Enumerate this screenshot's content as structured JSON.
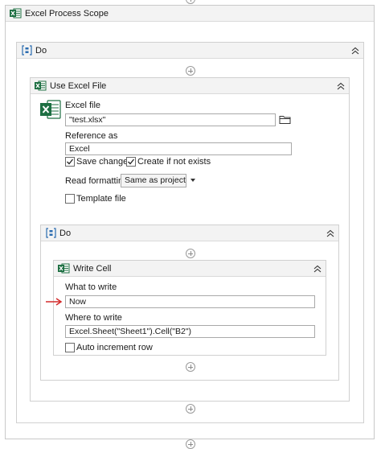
{
  "excel_scope": {
    "title": "Excel Process Scope"
  },
  "outer_do": {
    "title": "Do"
  },
  "use_excel": {
    "title": "Use Excel File",
    "excel_file_label": "Excel file",
    "excel_file_value": "\"test.xlsx\"",
    "reference_label": "Reference as",
    "reference_value": "Excel",
    "save_changes_label": "Save changes",
    "save_changes_checked": true,
    "create_if_not_exists_label": "Create if not exists",
    "create_if_not_exists_checked": true,
    "read_formatting_label": "Read formatting",
    "read_formatting_value": "Same as project",
    "template_file_label": "Template file",
    "template_file_checked": false
  },
  "inner_do": {
    "title": "Do"
  },
  "write_cell": {
    "title": "Write Cell",
    "what_label": "What to write",
    "what_value": "Now",
    "where_label": "Where to write",
    "where_value": "Excel.Sheet(\"Sheet1\").Cell(\"B2\")",
    "auto_increment_label": "Auto increment row",
    "auto_increment_checked": false
  },
  "colors": {
    "excel_green": "#1d6f42",
    "do_blue": "#2b6cb0",
    "arrow_red": "#d42b2b"
  },
  "icons": [
    "excel-icon",
    "sequence-icon",
    "collapse-chevron-icon",
    "folder-icon",
    "add-activity-icon",
    "arrow-icon"
  ]
}
